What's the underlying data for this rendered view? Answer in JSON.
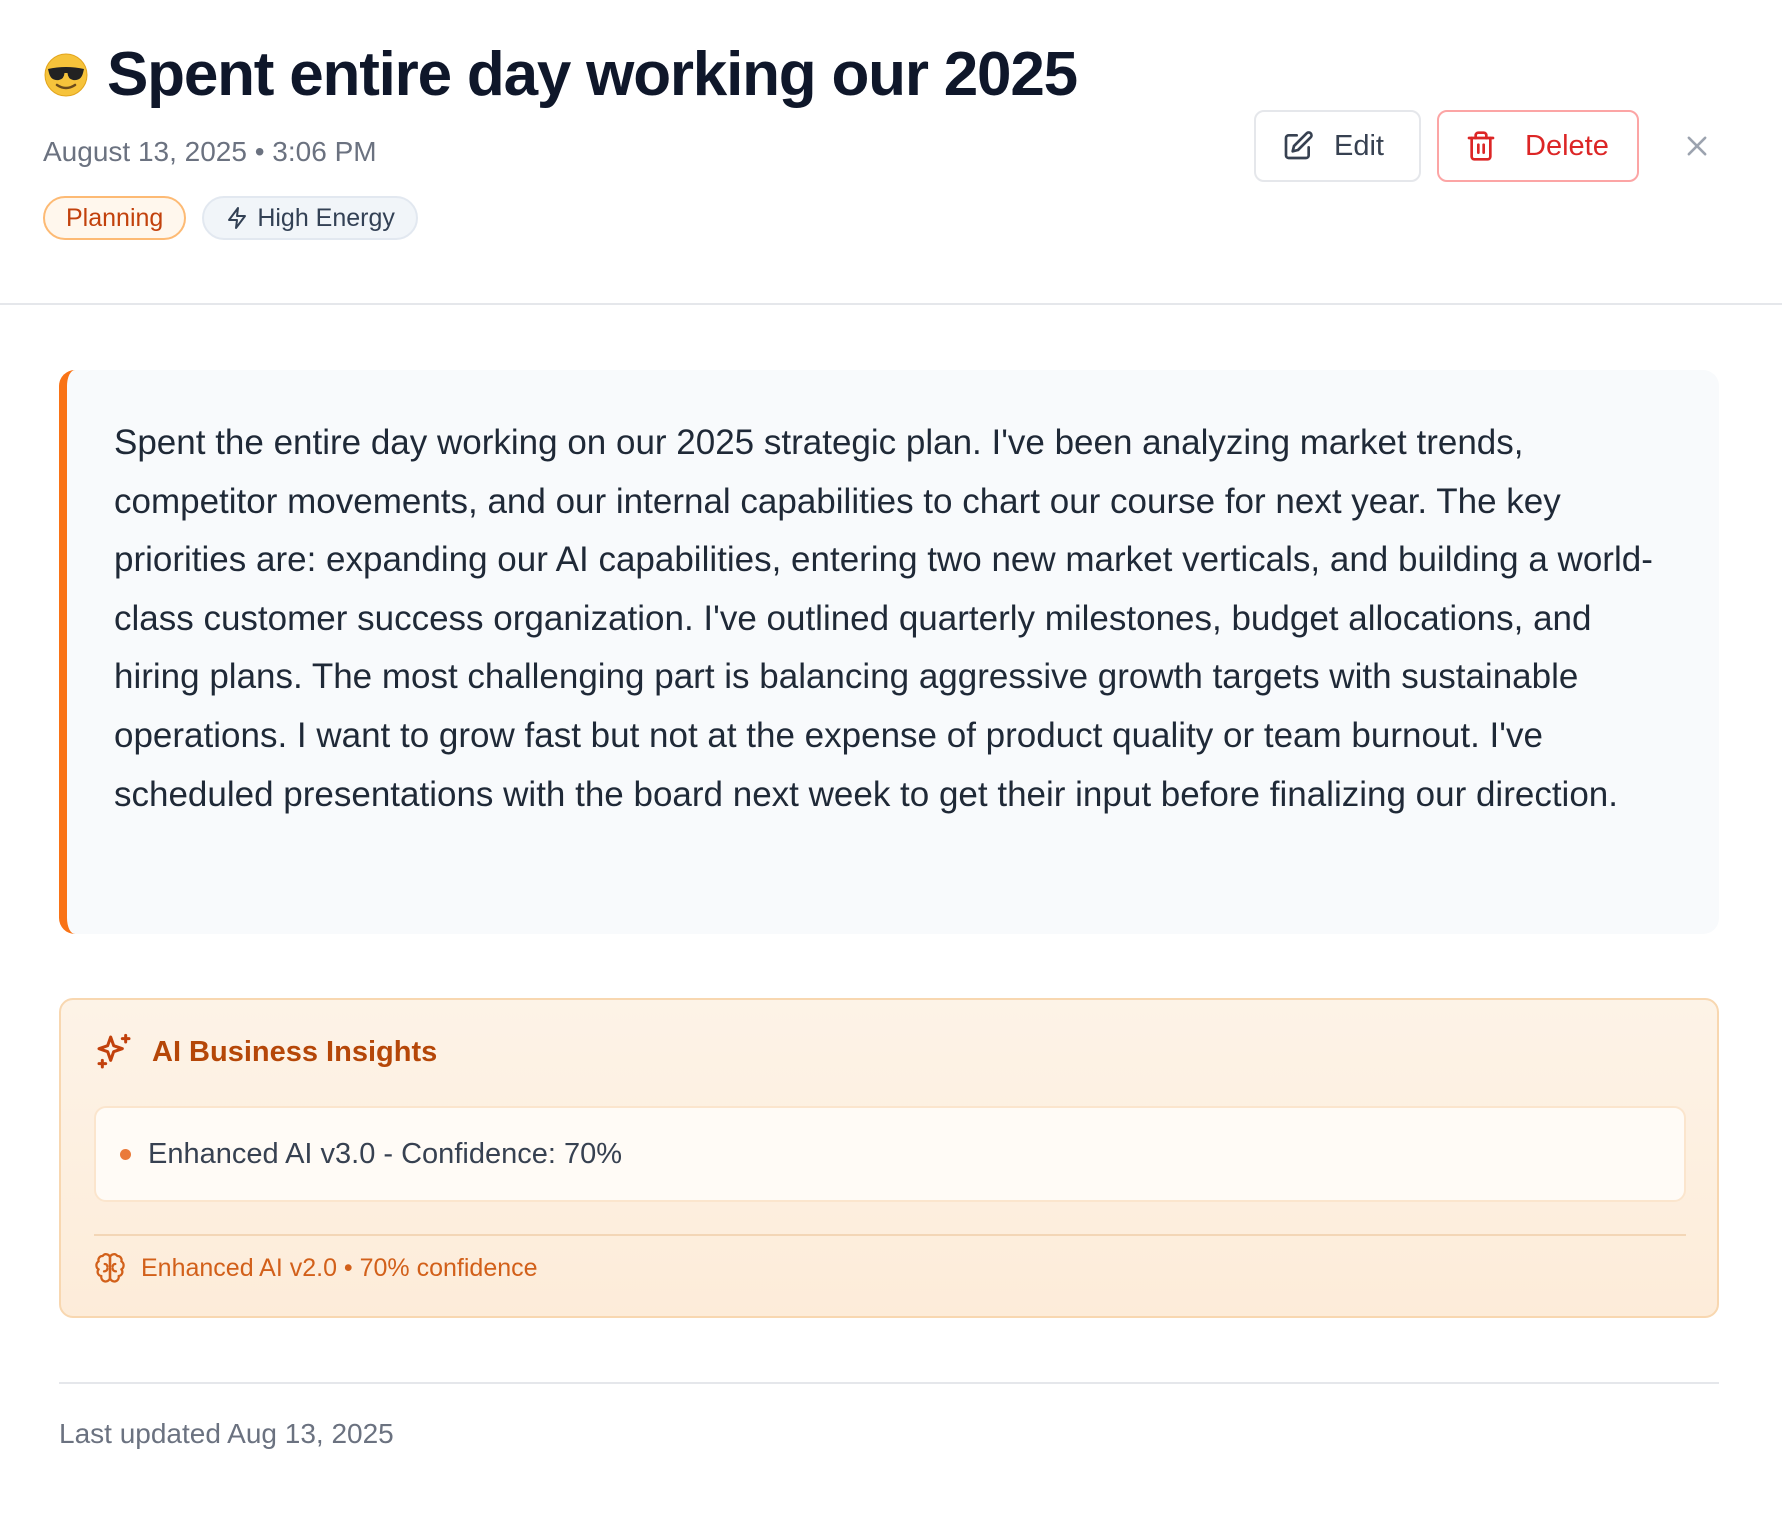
{
  "header": {
    "emoji_icon": "smiling-face-with-sunglasses",
    "title": "Spent entire day working our 2025",
    "meta": "August 13, 2025 • 3:06 PM",
    "tags": [
      {
        "label": "Planning"
      },
      {
        "label": "High Energy",
        "icon": "lightning-icon"
      }
    ],
    "actions": {
      "edit_label": "Edit",
      "delete_label": "Delete",
      "close_icon": "close-icon"
    }
  },
  "entry": {
    "accent_color": "#f97316",
    "text": "Spent the entire day working on our 2025 strategic plan. I've been analyzing market trends, competitor movements, and our internal capabilities to chart our course for next year. The key priorities are: expanding our AI capabilities, entering two new market verticals, and building a world-class customer success organization. I've outlined quarterly milestones, budget allocations, and hiring plans. The most challenging part is balancing aggressive growth targets with sustainable operations. I want to grow fast but not at the expense of product quality or team burnout. I've scheduled presentations with the board next week to get their input before finalizing our direction."
  },
  "insights": {
    "title": "AI Business Insights",
    "title_icon": "sparkles-icon",
    "items": [
      {
        "text": "Enhanced AI v3.0 - Confidence: 70%"
      }
    ],
    "footer": "Enhanced AI v2.0 • 70% confidence",
    "footer_icon": "brain-icon",
    "accent_color": "#b54708"
  },
  "footer": {
    "last_updated": "Last updated Aug 13, 2025"
  }
}
